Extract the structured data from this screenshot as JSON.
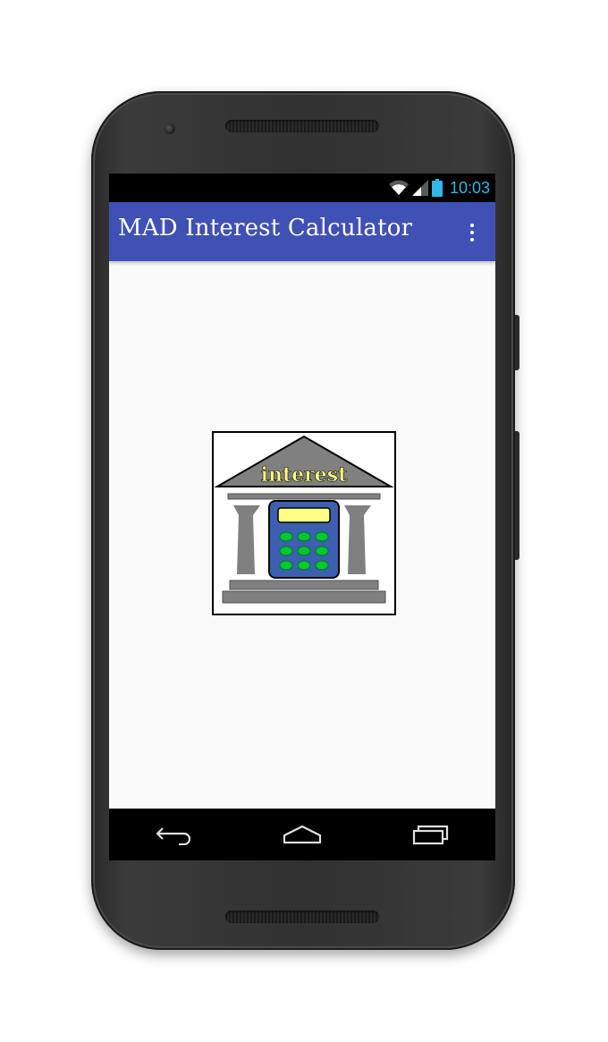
{
  "status_bar": {
    "time": "10:03",
    "icons": [
      "wifi-icon",
      "signal-icon",
      "battery-icon"
    ],
    "time_color": "#33b5e5"
  },
  "app_bar": {
    "title": "MAD Interest Calculator",
    "color": "#3f51b5",
    "menu_icon": "overflow-menu-icon"
  },
  "content": {
    "logo": {
      "label": "interest",
      "icons": [
        "bank-building-icon",
        "calculator-icon"
      ]
    }
  },
  "nav_bar": {
    "buttons": [
      "back-icon",
      "home-icon",
      "recents-icon"
    ]
  }
}
